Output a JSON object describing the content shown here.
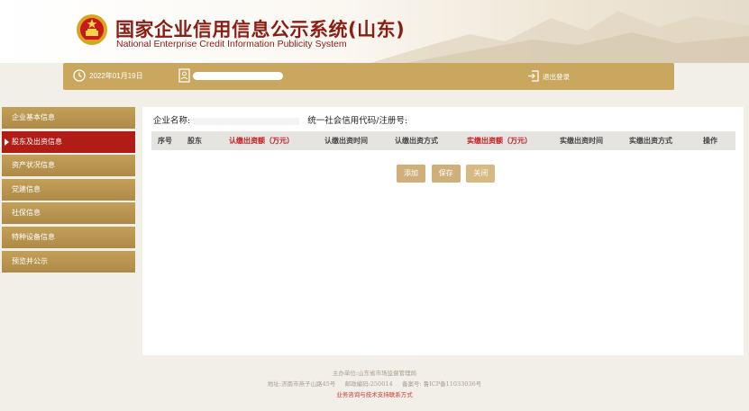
{
  "header": {
    "title_cn": "国家企业信用信息公示系统(山东)",
    "title_en": "National Enterprise Credit Information Publicity System"
  },
  "topbar": {
    "date": "2022年01月19日",
    "logout": "退出登录"
  },
  "sidebar": {
    "items": [
      {
        "label": "企业基本信息"
      },
      {
        "label": "股东及出资信息"
      },
      {
        "label": "资产状况信息"
      },
      {
        "label": "党建信息"
      },
      {
        "label": "社保信息"
      },
      {
        "label": "特种设备信息"
      },
      {
        "label": "预览并公示"
      }
    ]
  },
  "main": {
    "company_label": "企业名称:",
    "code_label": "统一社会信用代码/注册号:",
    "table": {
      "columns": [
        {
          "label": "序号",
          "required": false
        },
        {
          "label": "股东",
          "required": false
        },
        {
          "label": "认缴出资额（万元）",
          "required": true
        },
        {
          "label": "认缴出资时间",
          "required": false
        },
        {
          "label": "认缴出资方式",
          "required": false
        },
        {
          "label": "实缴出资额（万元）",
          "required": true
        },
        {
          "label": "实缴出资时间",
          "required": false
        },
        {
          "label": "实缴出资方式",
          "required": false
        },
        {
          "label": "操作",
          "required": false
        }
      ]
    },
    "buttons": {
      "add": "添加",
      "save": "保存",
      "close": "关闭"
    }
  },
  "footer": {
    "line1": "主办单位:山东省市场监督管理局",
    "line2_address": "地址:济南市燕子山路45号",
    "line2_postcode": "邮政编码:250014",
    "line2_icp": "备案号: 鲁ICP备11033036号",
    "line3": "业务咨询与技术支持联系方式"
  },
  "colors": {
    "gold": "#c9a75f",
    "active_red": "#b01d16",
    "title_red": "#8a1d14",
    "required_red": "#c8191d"
  }
}
